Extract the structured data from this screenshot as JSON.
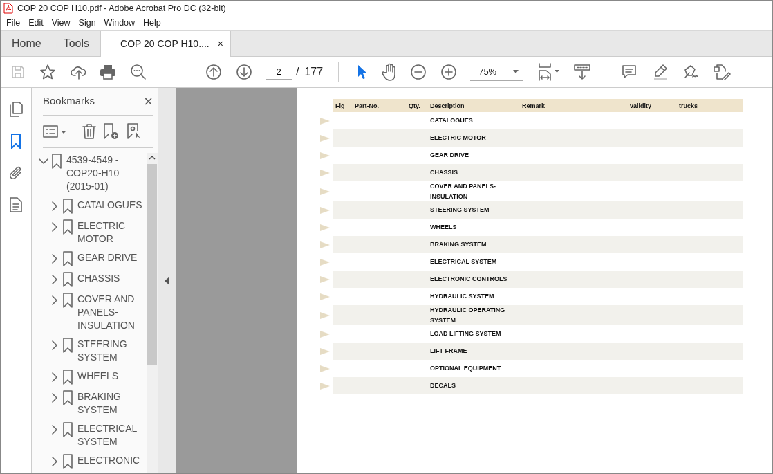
{
  "window": {
    "title": "COP 20 COP H10.pdf - Adobe Acrobat Pro DC (32-bit)"
  },
  "menu": [
    "File",
    "Edit",
    "View",
    "Sign",
    "Window",
    "Help"
  ],
  "tabs": [
    {
      "label": "Home",
      "selected": false
    },
    {
      "label": "Tools",
      "selected": false
    },
    {
      "label": "COP 20 COP H10....",
      "selected": true,
      "close": "×"
    }
  ],
  "toolbar": {
    "page": "2",
    "separator": "/",
    "page_count": "177",
    "zoom": "75%"
  },
  "sidebar": {
    "items": [
      {
        "kind": "pages",
        "selected": false
      },
      {
        "kind": "bookmarks",
        "selected": true
      },
      {
        "kind": "attachments",
        "selected": false
      },
      {
        "kind": "document",
        "selected": false
      }
    ]
  },
  "bookmarks": {
    "title": "Bookmarks",
    "close": "×",
    "tree": [
      {
        "label": "4539-4549 - COP20-H10 (2015-01)",
        "expanded": true,
        "children": [
          {
            "label": "CATALOGUES",
            "expanded": false
          },
          {
            "label": "ELECTRIC MOTOR",
            "expanded": false
          },
          {
            "label": "GEAR DRIVE",
            "expanded": false
          },
          {
            "label": "CHASSIS",
            "expanded": false
          },
          {
            "label": "COVER AND PANELS-INSULATION",
            "expanded": false
          },
          {
            "label": "STEERING SYSTEM",
            "expanded": false
          },
          {
            "label": "WHEELS",
            "expanded": false
          },
          {
            "label": "BRAKING SYSTEM",
            "expanded": false
          },
          {
            "label": "ELECTRICAL SYSTEM",
            "expanded": false
          },
          {
            "label": "ELECTRONIC",
            "expanded": false
          }
        ]
      }
    ]
  },
  "document": {
    "table": {
      "columns": [
        "Fig",
        "Part-No.",
        "Qty.",
        "Description",
        "Remark",
        "validity",
        "trucks"
      ],
      "rows": [
        {
          "description": "CATALOGUES"
        },
        {
          "description": "ELECTRIC MOTOR"
        },
        {
          "description": "GEAR DRIVE"
        },
        {
          "description": "CHASSIS"
        },
        {
          "description": "COVER AND PANELS-\nINSULATION"
        },
        {
          "description": "STEERING SYSTEM"
        },
        {
          "description": "WHEELS"
        },
        {
          "description": "BRAKING SYSTEM"
        },
        {
          "description": "ELECTRICAL SYSTEM"
        },
        {
          "description": "ELECTRONIC CONTROLS"
        },
        {
          "description": "HYDRAULIC SYSTEM"
        },
        {
          "description": "HYDRAULIC OPERATING\nSYSTEM"
        },
        {
          "description": "LOAD LIFTING SYSTEM"
        },
        {
          "description": "LIFT FRAME"
        },
        {
          "description": "OPTIONAL EQUIPMENT"
        },
        {
          "description": "DECALS"
        }
      ]
    }
  }
}
